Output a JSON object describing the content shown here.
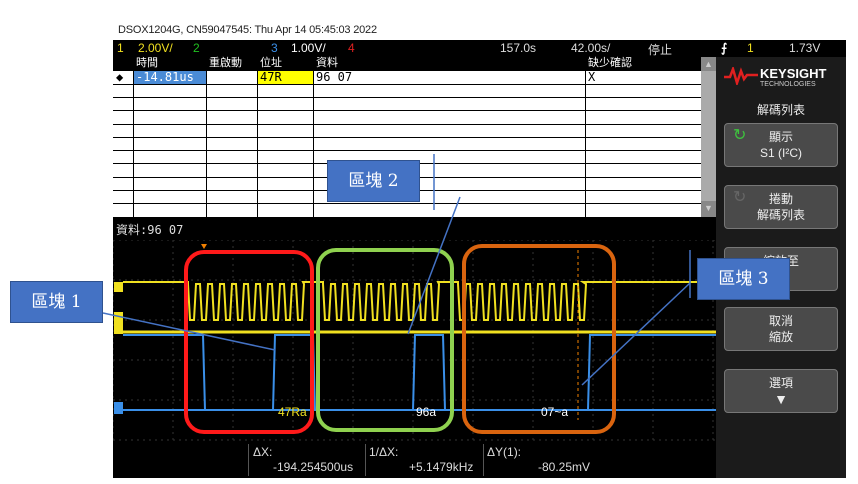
{
  "header": {
    "title": "DSOX1204G, CN59047545: Thu Apr 14 05:45:03 2022"
  },
  "status": {
    "ch1_num": "1",
    "ch1_scale": "2.00V/",
    "ch2_num": "2",
    "ch3_num": "3",
    "ch3_scale": "1.00V/",
    "ch4_num": "4",
    "time_offset": "157.0s",
    "time_scale": "42.00s/",
    "run_state": "停止",
    "trig_icon": "trigger-edge-icon",
    "trig_ch": "1",
    "trig_level": "1.73V"
  },
  "table": {
    "columns": [
      "時間",
      "重啟動",
      "位址",
      "資料",
      "缺少確認"
    ],
    "rows": [
      {
        "time": "-14.81us",
        "restart": "",
        "address": "47R",
        "data": "96 07",
        "missing_ack": "X"
      }
    ]
  },
  "data_label": "資料:96 07",
  "brand": {
    "name": "KEYSIGHT",
    "sub": "TECHNOLOGIES"
  },
  "panel": {
    "title": "解碼列表",
    "buttons": [
      {
        "line1": "顯示",
        "line2": "S1 (I²C)"
      },
      {
        "line1": "捲動",
        "line2": "解碼列表"
      },
      {
        "line1": "縮放至",
        "line2": ""
      },
      {
        "line1": "取消",
        "line2": "縮放"
      },
      {
        "line1": "選項",
        "line2": ""
      }
    ]
  },
  "decode_labels": [
    "47Ra",
    "96a",
    "07~a"
  ],
  "measure": {
    "dx_label": "ΔX:",
    "dx_value": "-194.254500us",
    "inv_label": "1/ΔX:",
    "inv_value": "+5.1479kHz",
    "dy_label": "ΔY(1):",
    "dy_value": "-80.25mV"
  },
  "callouts": {
    "b1": "區塊 1",
    "b2": "區塊 2",
    "b3": "區塊 3"
  },
  "colors": {
    "ch1": "#f0e020",
    "ch2": "#20c020",
    "ch3": "#3a8fe8",
    "ch4": "#e02020",
    "region1": "#ff1a1a",
    "region2": "#8fd14f",
    "region3": "#d9640f"
  }
}
